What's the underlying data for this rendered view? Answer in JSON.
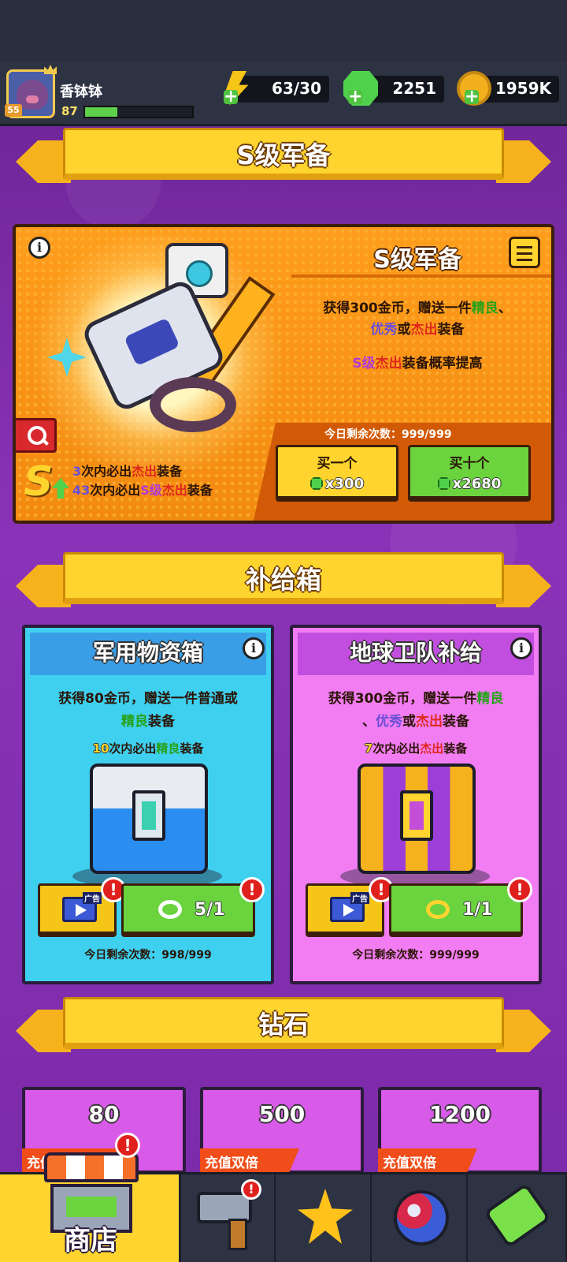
{
  "header": {
    "player_name": "香钵钵",
    "avatar_level": "55",
    "player_level": "87",
    "xp_progress": 0.3,
    "energy": "63/30",
    "gems": "2251",
    "coins": "1959K"
  },
  "s_section": {
    "banner_title": "S级军备",
    "card_title": "S级军备",
    "desc_pre": "获得300金币，赠送一件",
    "desc_good": "精良",
    "desc_sep": "、",
    "desc_excellent": "优秀",
    "desc_or": "或",
    "desc_outstanding": "杰出",
    "desc_post": "装备",
    "rate_prefix": "S级",
    "rate_outstanding": "杰出",
    "rate_suffix": "装备概率提高",
    "pity1_num": "3",
    "pity1_mid": "次内必出",
    "pity1_quality": "杰出",
    "pity1_end": "装备",
    "pity2_num": "43",
    "pity2_mid": "次内必出",
    "pity2_quality_s": "S级",
    "pity2_quality": "杰出",
    "pity2_end": "装备",
    "remaining": "今日剩余次数：999/999",
    "buy_one_label": "买一个",
    "buy_one_cost": "x300",
    "buy_ten_label": "买十个",
    "buy_ten_cost": "x2680"
  },
  "supply_section": {
    "banner_title": "补给箱",
    "military": {
      "title": "军用物资箱",
      "desc_pre": "获得80金币，赠送一件普通或",
      "desc_good": "精良",
      "desc_post": "装备",
      "pity_num": "10",
      "pity_mid": "次内必出",
      "pity_quality": "精良",
      "pity_end": "装备",
      "ad_tag": "广告",
      "keys": "5/1",
      "remaining": "今日剩余次数：998/999"
    },
    "earth": {
      "title": "地球卫队补给",
      "desc_pre": "获得300金币，赠送一件",
      "desc_good": "精良",
      "desc_sep": "、",
      "desc_excellent": "优秀",
      "desc_or": "或",
      "desc_outstanding": "杰出",
      "desc_post": "装备",
      "pity_num": "7",
      "pity_mid": "次内必出",
      "pity_quality": "杰出",
      "pity_end": "装备",
      "ad_tag": "广告",
      "keys": "1/1",
      "remaining": "今日剩余次数：999/999"
    }
  },
  "diamond_section": {
    "banner_title": "钻石",
    "packs": [
      {
        "amount": "80",
        "band": "充值双倍"
      },
      {
        "amount": "500",
        "band": "充值双倍"
      },
      {
        "amount": "1200",
        "band": "充值双倍"
      }
    ]
  },
  "bottom_nav": {
    "shop_label": "商店",
    "alert_mark": "!"
  },
  "icons": {
    "info": "i",
    "alert": "!"
  },
  "colors": {
    "good": "#27a21a",
    "excellent": "#6b4fd6",
    "outstanding": "#e0281d",
    "s_grade": "#b13ad6",
    "accent_yellow": "#ffd42e"
  }
}
